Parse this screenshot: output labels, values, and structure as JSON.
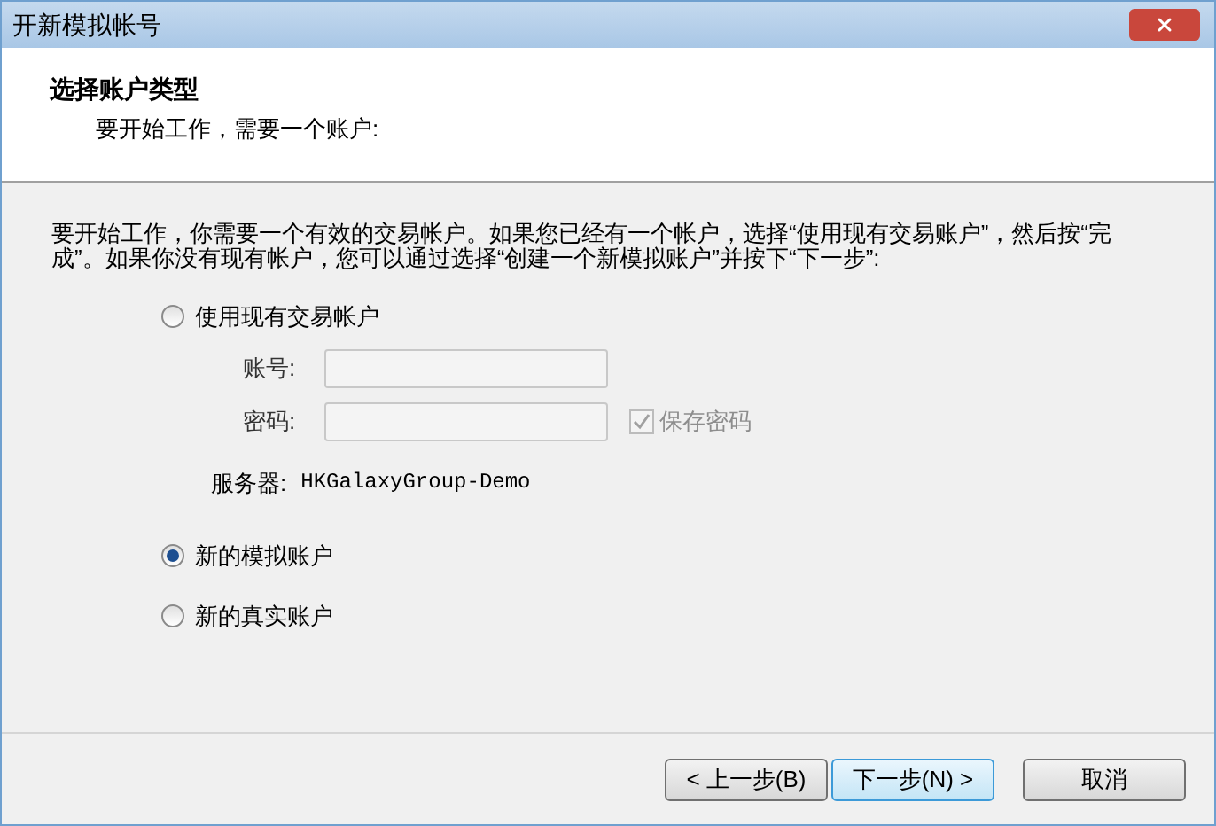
{
  "window": {
    "title": "开新模拟帐号"
  },
  "header": {
    "title": "选择账户类型",
    "subtitle": "要开始工作，需要一个账户:"
  },
  "description": "要开始工作，你需要一个有效的交易帐户。如果您已经有一个帐户，选择“使用现有交易账户”，然后按“完成”。如果你没有现有帐户，您可以通过选择“创建一个新模拟账户”并按下“下一步”:",
  "existing_option": {
    "label": "使用现有交易帐户",
    "selected": false
  },
  "fields": [
    {
      "label": "账号:",
      "disabled": true
    },
    {
      "label": "密码:",
      "disabled": true
    }
  ],
  "save_password": {
    "label": "保存密码",
    "checked": true,
    "disabled": true
  },
  "server": {
    "label": "服务器:",
    "value": "HKGalaxyGroup-Demo"
  },
  "other_options": [
    {
      "label": "新的模拟账户",
      "selected": true
    },
    {
      "label": "新的真实账户",
      "selected": false
    }
  ],
  "buttons": [
    {
      "label": "< 上一步(B)",
      "default": false
    },
    {
      "label": "下一步(N) >",
      "default": true
    },
    {
      "label": "取消",
      "default": false
    }
  ]
}
